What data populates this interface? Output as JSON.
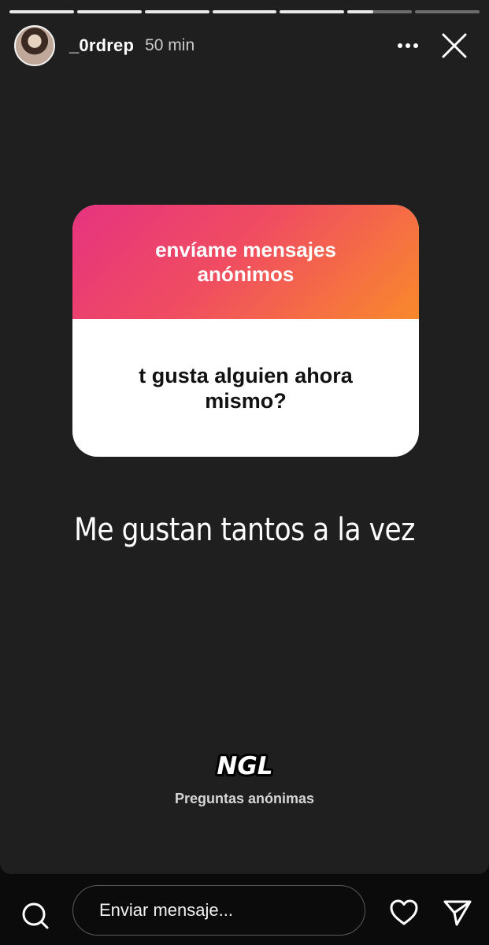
{
  "progress": {
    "segments": 7,
    "current_index": 5,
    "current_fill_fraction": 0.4
  },
  "header": {
    "username": "_0rdrep",
    "time": "50 min"
  },
  "question_card": {
    "title": "envíame mensajes anónimos",
    "question": "t gusta alguien ahora mismo?"
  },
  "answer_text": "Me gustan tantos a la vez",
  "branding": {
    "logo_text": "NGL",
    "subtitle": "Preguntas anónimas"
  },
  "composer": {
    "placeholder": "Enviar mensaje..."
  },
  "icons": {
    "more": "more-horizontal-icon",
    "close": "close-icon",
    "search": "search-icon",
    "like": "heart-icon",
    "send": "send-icon"
  },
  "colors": {
    "gradient_start": "#e6337f",
    "gradient_end": "#f9892b",
    "story_background": "#1f1f1f"
  }
}
